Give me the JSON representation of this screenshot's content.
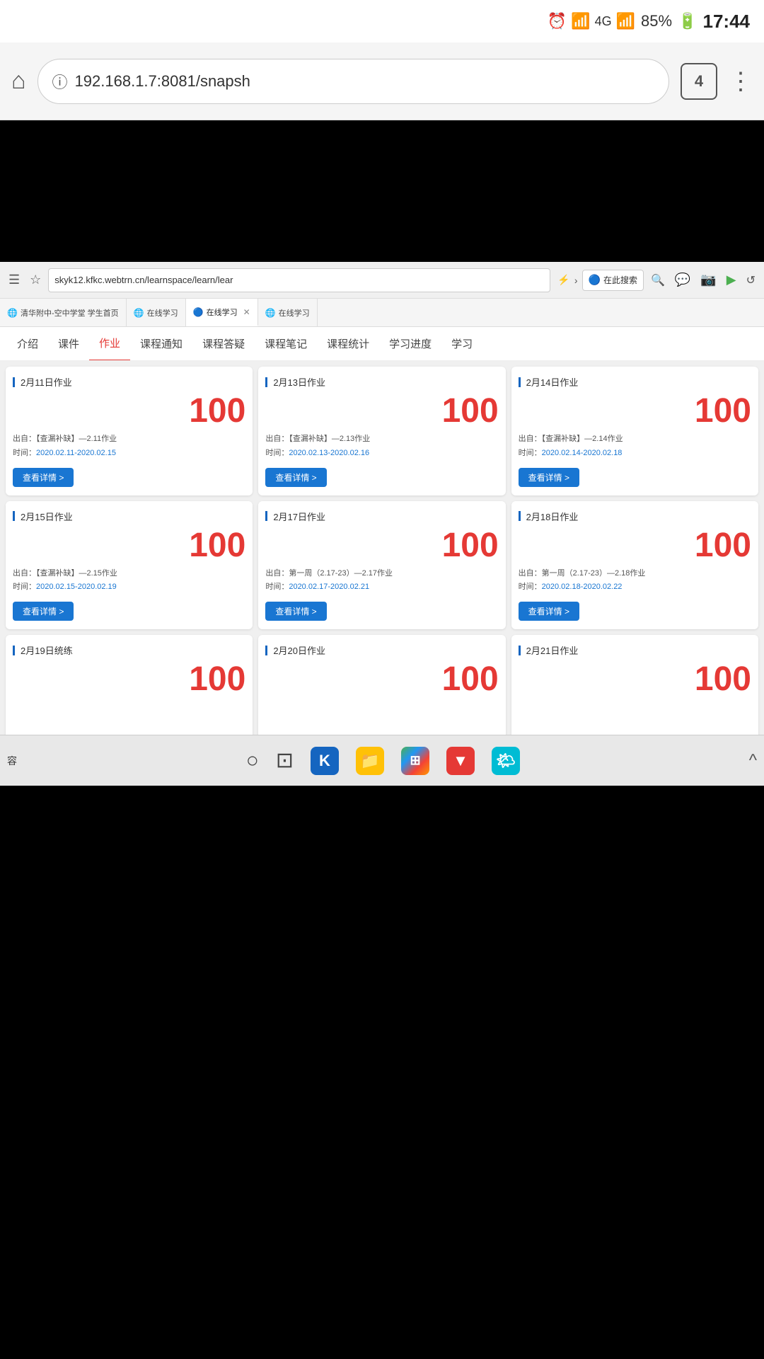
{
  "status_bar": {
    "battery": "85%",
    "time": "17:44",
    "signal_icons": "🕐 📶 4G"
  },
  "browser": {
    "address": "192.168.1.7:8081/snapsh",
    "tab_count": "4",
    "home_icon": "⌂",
    "info_icon": "ⓘ",
    "menu_icon": "⋮"
  },
  "inner_browser": {
    "url": "skyk12.kfkc.webtrn.cn/learnspace/learn/lear",
    "search_placeholder": "在此搜索"
  },
  "tabs": [
    {
      "label": "清华附中-空中学堂 学生首页",
      "active": false,
      "favicon": "🌐"
    },
    {
      "label": "在线学习",
      "active": false,
      "favicon": "🌐"
    },
    {
      "label": "在线学习",
      "active": true,
      "favicon": "🔵"
    },
    {
      "label": "在线学习",
      "active": false,
      "favicon": "🌐"
    }
  ],
  "nav_items": [
    {
      "label": "介绍",
      "active": false
    },
    {
      "label": "课件",
      "active": false
    },
    {
      "label": "作业",
      "active": true
    },
    {
      "label": "课程通知",
      "active": false
    },
    {
      "label": "课程答疑",
      "active": false
    },
    {
      "label": "课程笔记",
      "active": false
    },
    {
      "label": "课程统计",
      "active": false
    },
    {
      "label": "学习进度",
      "active": false
    },
    {
      "label": "学习",
      "active": false
    }
  ],
  "homework_cards": [
    {
      "title": "2月11日作业",
      "score": "100",
      "source": "【查漏补缺】—2.11作业",
      "time_label": "时间：",
      "time_val": "2020.02.11-2020.02.15",
      "btn_label": "查看详情 >"
    },
    {
      "title": "2月13日作业",
      "score": "100",
      "source": "【查漏补缺】—2.13作业",
      "time_label": "时间：",
      "time_val": "2020.02.13-2020.02.16",
      "btn_label": "查看详情 >"
    },
    {
      "title": "2月14日作业",
      "score": "100",
      "source": "【查漏补缺】—2.14作业",
      "time_label": "时间：",
      "time_val": "2020.02.14-2020.02.18",
      "btn_label": "查看详情 >"
    },
    {
      "title": "2月15日作业",
      "score": "100",
      "source": "【查漏补缺】—2.15作业",
      "time_label": "时间：",
      "time_val": "2020.02.15-2020.02.19",
      "btn_label": "查看详情 >"
    },
    {
      "title": "2月17日作业",
      "score": "100",
      "source": "第一周（2.17-23）—2.17作业",
      "time_label": "时间：",
      "time_val": "2020.02.17-2020.02.21",
      "btn_label": "查看详情 >"
    },
    {
      "title": "2月18日作业",
      "score": "100",
      "source": "第一周（2.17-23）—2.18作业",
      "time_label": "时间：",
      "time_val": "2020.02.18-2020.02.22",
      "btn_label": "查看详情 >"
    },
    {
      "title": "2月19日统练",
      "score": "100",
      "source": "",
      "time_label": "",
      "time_val": "",
      "btn_label": ""
    },
    {
      "title": "2月20日作业",
      "score": "100",
      "source": "",
      "time_label": "",
      "time_val": "",
      "btn_label": ""
    },
    {
      "title": "2月21日作业",
      "score": "100",
      "source": "",
      "time_label": "",
      "time_val": "",
      "btn_label": ""
    }
  ],
  "taskbar": {
    "label": "容",
    "expand_icon": "^"
  }
}
